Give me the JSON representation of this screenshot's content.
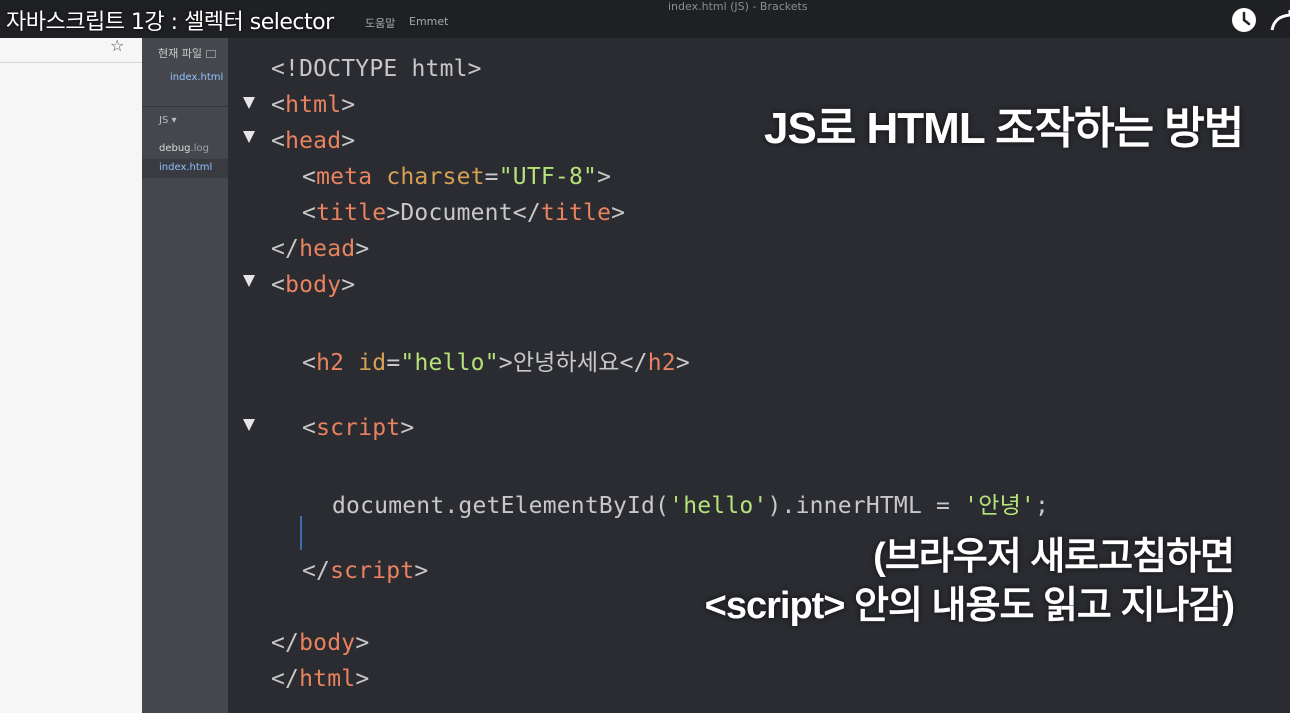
{
  "video": {
    "title": "자바스크립트 1강 : 셀렉터 selector"
  },
  "menu": {
    "help": "도움말",
    "emmet": "Emmet"
  },
  "window": {
    "title": "index.html (JS) - Brackets"
  },
  "sidebar": {
    "working_files_title": "현재 파일",
    "working_file": "index.html",
    "project_name": "JS",
    "files": [
      {
        "name": "debug",
        "ext": ".log"
      },
      {
        "name": "index.html",
        "ext": ""
      }
    ]
  },
  "code": {
    "l1": "<!DOCTYPE html>",
    "l2_tag": "html",
    "l3_tag": "head",
    "l4_tag": "meta",
    "l4_attr": "charset",
    "l4_val": "\"UTF-8\"",
    "l5_tag": "title",
    "l5_text": "Document",
    "l6_tag": "head",
    "l7_tag": "body",
    "l8_tag": "h2",
    "l8_attr": "id",
    "l8_val": "\"hello\"",
    "l8_text": "안녕하세요",
    "l9_tag": "script",
    "l10_pre": "document.getElementById(",
    "l10_arg": "'hello'",
    "l10_mid": ").innerHTML = ",
    "l10_val": "'안녕'",
    "l10_end": ";",
    "l11_tag": "script",
    "l12_tag": "body",
    "l13_tag": "html"
  },
  "overlay": {
    "title": "JS로 HTML 조작하는 방법",
    "note_line1": "(브라우저 새로고침하면",
    "note_line2": "<script> 안의 내용도 읽고 지나감)"
  },
  "colors": {
    "tag": "#e8825f",
    "attribute": "#d6a155",
    "string": "#b6e27a",
    "sidebar_link": "#8fc1ff"
  }
}
